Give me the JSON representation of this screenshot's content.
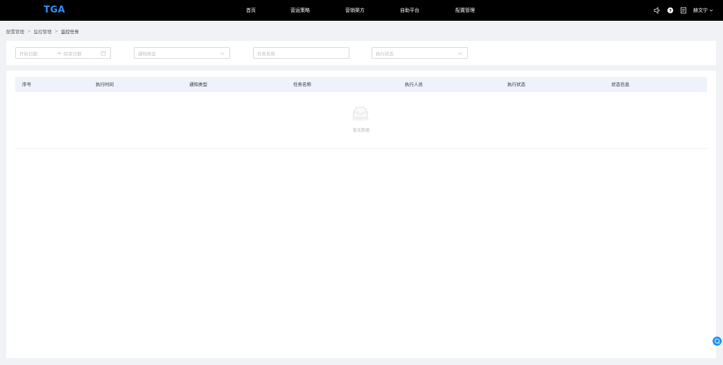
{
  "app": {
    "logo": "TGA"
  },
  "nav": {
    "items": [
      {
        "label": "首页"
      },
      {
        "label": "营运策略"
      },
      {
        "label": "营销渠方"
      },
      {
        "label": "自助平台"
      },
      {
        "label": "配置管理"
      }
    ]
  },
  "header": {
    "icons": [
      "speaker-icon",
      "help-icon",
      "document-icon"
    ],
    "user_name": "赫文宁"
  },
  "breadcrumb": {
    "items": [
      "配置管理",
      "监控管理",
      "监控任务"
    ]
  },
  "filters": {
    "start_date_placeholder": "开始日期",
    "range_separator": "→",
    "end_date_placeholder": "结束日期",
    "type_placeholder": "通知类型",
    "task_name_placeholder": "任务名称",
    "status_placeholder": "执行状态"
  },
  "table": {
    "columns": [
      "序号",
      "执行时间",
      "通知类型",
      "任务名称",
      "执行人员",
      "执行状态",
      "状态信息"
    ],
    "rows": [],
    "empty_text": "暂无数据"
  },
  "colors": {
    "topbar": "#000000",
    "logo": "#2f8fff",
    "header_row": "#eef3fb",
    "accent": "#1890ff"
  }
}
